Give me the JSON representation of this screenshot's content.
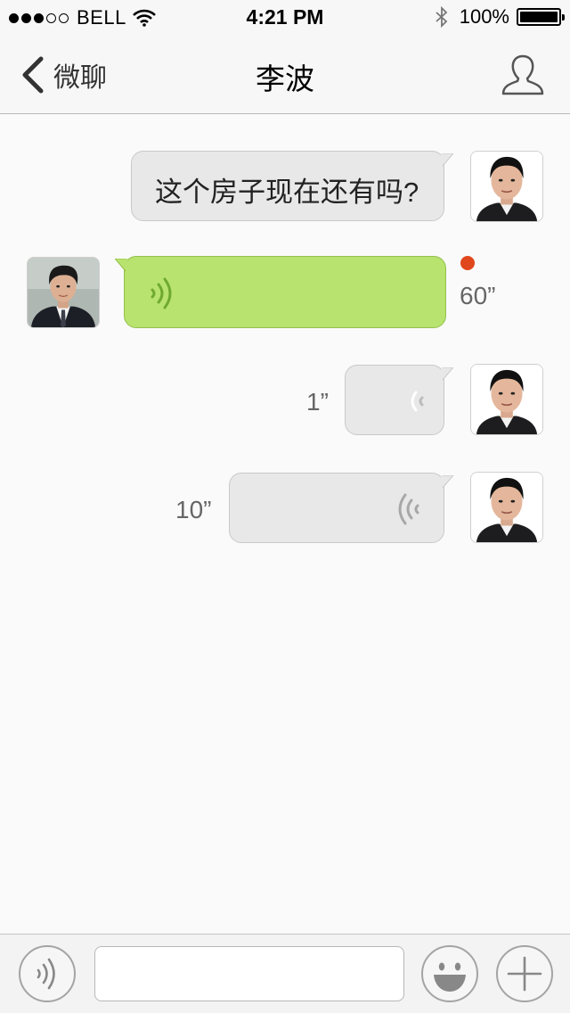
{
  "status_bar": {
    "carrier": "BELL",
    "time": "4:21 PM",
    "battery_percent": "100%",
    "signal_bars_filled": 3,
    "signal_bars_total": 5
  },
  "nav_bar": {
    "back_label": "微聊",
    "title": "李波",
    "icons": {
      "back": "chevron-left-icon",
      "profile": "person-outline-icon"
    }
  },
  "messages": [
    {
      "sender": "self",
      "type": "text",
      "text": "这个房子现在还有吗?"
    },
    {
      "sender": "contact",
      "type": "voice",
      "duration": "60”",
      "unread": true
    },
    {
      "sender": "self",
      "type": "voice",
      "duration": "1”"
    },
    {
      "sender": "self",
      "type": "voice",
      "duration": "10”"
    }
  ],
  "input_bar": {
    "text_value": "",
    "icons": {
      "voice": "voice-wave-icon",
      "emoji": "smiley-icon",
      "more": "plus-icon"
    }
  },
  "colors": {
    "self_bubble": "#e8e8e8",
    "contact_bubble": "#b8e36e",
    "voice_wave_green": "#6fa932",
    "unread_dot": "#e0471c",
    "bar_background": "#f7f7f7"
  }
}
